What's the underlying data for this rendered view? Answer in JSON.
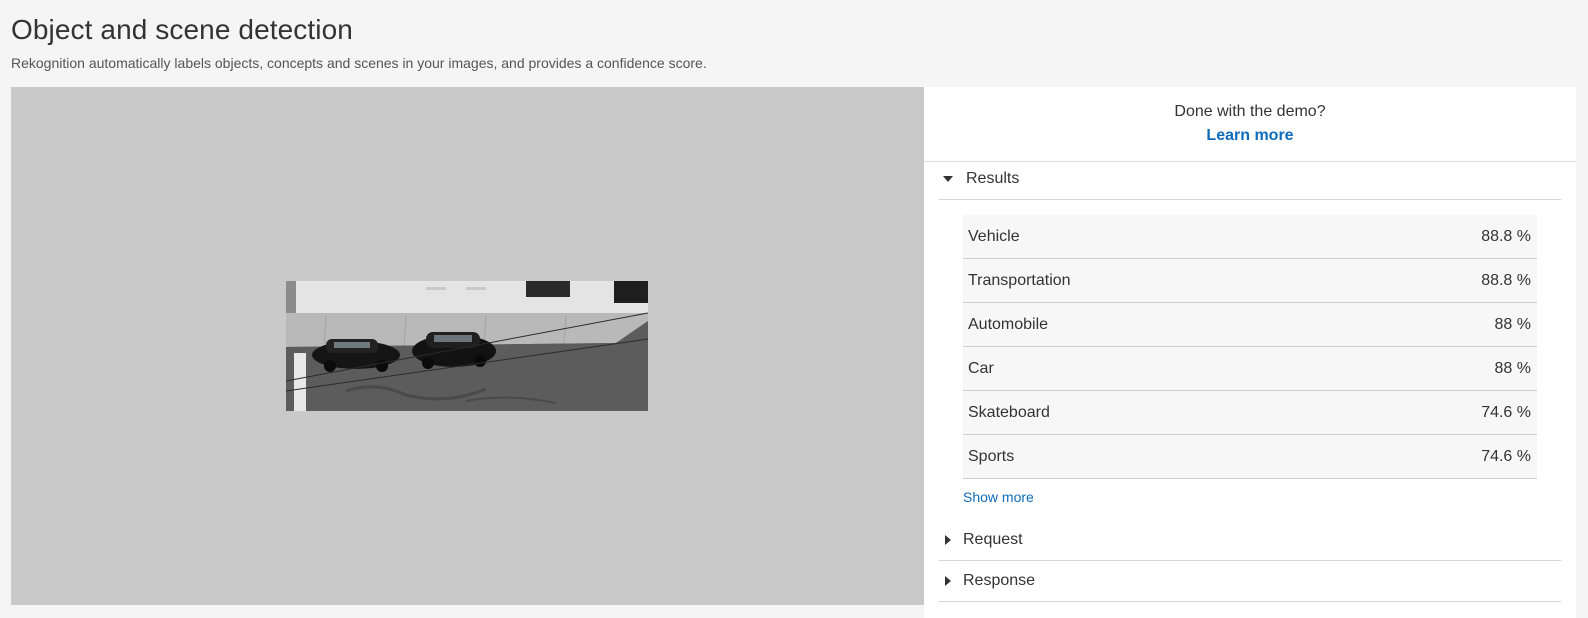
{
  "header": {
    "title": "Object and scene detection",
    "subtitle": "Rekognition automatically labels objects, concepts and scenes in your images, and provides a confidence score."
  },
  "side_panel": {
    "done_text": "Done with the demo?",
    "learn_more": "Learn more",
    "results_label": "Results",
    "results": [
      {
        "label": "Vehicle",
        "value": "88.8 %"
      },
      {
        "label": "Transportation",
        "value": "88.8 %"
      },
      {
        "label": "Automobile",
        "value": "88 %"
      },
      {
        "label": "Car",
        "value": "88 %"
      },
      {
        "label": "Skateboard",
        "value": "74.6 %"
      },
      {
        "label": "Sports",
        "value": "74.6 %"
      }
    ],
    "show_more": "Show more",
    "request_label": "Request",
    "response_label": "Response"
  },
  "colors": {
    "link": "#0f6cbd",
    "image_backdrop": "#c9c9c9",
    "page_background": "#f5f5f5"
  }
}
